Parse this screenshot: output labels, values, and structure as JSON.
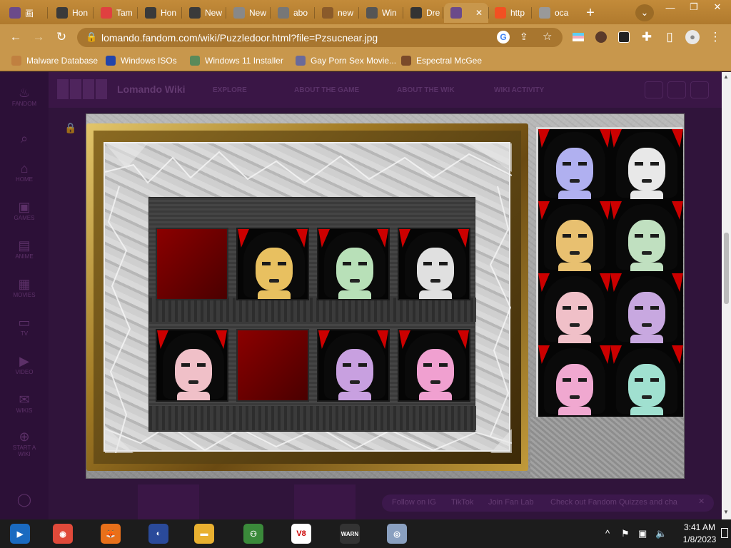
{
  "browser": {
    "tabs": [
      {
        "label": "画",
        "icon": "anime-face-icon",
        "color": "#6b4a8a"
      },
      {
        "label": "Hon",
        "icon": "game-pad-icon",
        "color": "#3a3a3a"
      },
      {
        "label": "Tam",
        "icon": "tamagotchi-icon",
        "color": "#e04040"
      },
      {
        "label": "Hon",
        "icon": "game-pad-icon",
        "color": "#3a3a3a"
      },
      {
        "label": "New",
        "icon": "game-pad-icon",
        "color": "#3a3a3a"
      },
      {
        "label": "New",
        "icon": "chrome-icon",
        "color": "#888888"
      },
      {
        "label": "abo",
        "icon": "globe-icon",
        "color": "#777777"
      },
      {
        "label": "new",
        "icon": "cookie-icon",
        "color": "#8a5a2a"
      },
      {
        "label": "Win",
        "icon": "archive-icon",
        "color": "#555555"
      },
      {
        "label": "Dre",
        "icon": "v8-icon",
        "color": "#333333"
      },
      {
        "label": "",
        "icon": "anime-face-icon",
        "color": "#6b4a8a",
        "close": "✕"
      },
      {
        "label": "http",
        "icon": "microsoft-icon",
        "color": "#f25022"
      },
      {
        "label": "oca",
        "icon": "globe-icon",
        "color": "#999999"
      }
    ],
    "new_tab": "+",
    "tab_search": "⌄",
    "window_controls": [
      "—",
      "❐",
      "✕"
    ],
    "url": "lomando.fandom.com/wiki/Puzzledoor.html?file=Pzsucnear.jpg",
    "bookmarks": [
      {
        "label": "Malware Database",
        "icon": "malware-icon",
        "color": "#c08040"
      },
      {
        "label": "Windows ISOs",
        "icon": "x-icon",
        "color": "#2244aa"
      },
      {
        "label": "Windows 11 Installer",
        "icon": "installer-icon",
        "color": "#5a8a5a"
      },
      {
        "label": "Gay Porn Sex Movie...",
        "icon": "box-icon",
        "color": "#6a6a9a"
      },
      {
        "label": "Espectral McGee",
        "icon": "character-icon",
        "color": "#7a4a2a"
      }
    ]
  },
  "wiki": {
    "title": "Lomando Wiki",
    "nav": [
      "EXPLORE",
      "ABOUT THE GAME",
      "ABOUT THE WIK",
      "WIKI ACTIVITY"
    ],
    "rail": [
      {
        "label": "FANDOM",
        "icon": "fandom-flame-icon",
        "glyph": "♨"
      },
      {
        "label": "",
        "icon": "search-icon",
        "glyph": "⌕"
      },
      {
        "label": "HOME",
        "icon": "home-icon",
        "glyph": "⌂"
      },
      {
        "label": "GAMES",
        "icon": "games-icon",
        "glyph": "▣"
      },
      {
        "label": "ANIME",
        "icon": "anime-icon",
        "glyph": "▤"
      },
      {
        "label": "MOVIES",
        "icon": "movies-icon",
        "glyph": "▦"
      },
      {
        "label": "TV",
        "icon": "tv-icon",
        "glyph": "▭"
      },
      {
        "label": "VIDEO",
        "icon": "video-icon",
        "glyph": "▶"
      },
      {
        "label": "WIKIS",
        "icon": "wikis-icon",
        "glyph": "✉"
      },
      {
        "label": "START A WIKI",
        "icon": "plus-circle-icon",
        "glyph": "⊕"
      },
      {
        "label": "",
        "icon": "user-icon",
        "glyph": "◯"
      }
    ],
    "followbar": [
      "Follow on IG",
      "TikTok",
      "Join Fan Lab",
      "Check out Fandom Quizzes and cha"
    ]
  },
  "puzzle": {
    "board": [
      {
        "type": "empty"
      },
      {
        "type": "doll",
        "color": "#e8c060"
      },
      {
        "type": "doll",
        "color": "#b8e0b8"
      },
      {
        "type": "doll",
        "color": "#e0e0e0"
      },
      {
        "type": "doll",
        "color": "#f0c0c8"
      },
      {
        "type": "empty"
      },
      {
        "type": "doll",
        "color": "#c8a0e0"
      },
      {
        "type": "doll",
        "color": "#f0a0d0"
      }
    ],
    "tray": [
      "#b0b0f0",
      "#e8e8e8",
      "#e8c070",
      "#c0e0c0",
      "#f0c0c8",
      "#c8a8e0",
      "#f0a8d0",
      "#a0e0d0"
    ]
  },
  "taskbar": {
    "apps": [
      {
        "name": "media-player-icon",
        "color": "#1a6ac0",
        "glyph": "▶"
      },
      {
        "name": "chrome-icon",
        "color": "#e04a3a",
        "glyph": "◉"
      },
      {
        "name": "firefox-icon",
        "color": "#e8701a",
        "glyph": "🦊"
      },
      {
        "name": "obama-logo-icon",
        "color": "#2a4a9a",
        "glyph": "◐"
      },
      {
        "name": "file-explorer-icon",
        "color": "#e8b030",
        "glyph": "▬"
      },
      {
        "name": "network-people-icon",
        "color": "#3a8a3a",
        "glyph": "⚇"
      },
      {
        "name": "v8-app-icon",
        "color": "#ffffff",
        "glyph": "V8"
      },
      {
        "name": "warning-terminal-icon",
        "color": "#333333",
        "glyph": "WARN"
      },
      {
        "name": "cd-installer-icon",
        "color": "#8aa0c0",
        "glyph": "◎"
      }
    ],
    "tray_icons": [
      "^",
      "⚑",
      "▣",
      "🔈"
    ],
    "time": "3:41 AM",
    "date": "1/8/2023"
  }
}
